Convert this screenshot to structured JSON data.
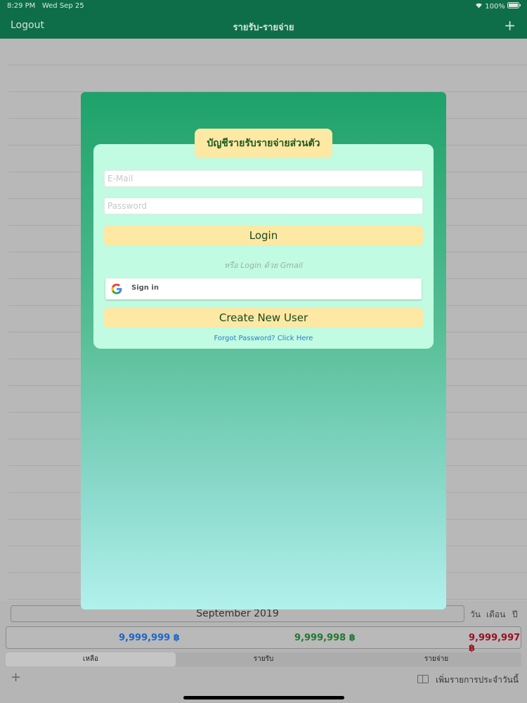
{
  "status_bar": {
    "time": "8:29 PM",
    "date": "Wed Sep 25",
    "battery": "100%"
  },
  "nav": {
    "logout_label": "Logout",
    "title": "รายรับ-รายจ่าย",
    "add_icon": "plus-icon"
  },
  "modal": {
    "header_badge": "บัญชีรายรับรายจ่ายส่วนตัว",
    "email_placeholder": "E-Mail",
    "password_placeholder": "Password",
    "login_label": "Login",
    "or_text": "หรือ Login ด้วย Gmail",
    "google_sign_in_label": "Sign in",
    "create_user_label": "Create New User",
    "forgot_password_label": "Forgot Password? Click Here"
  },
  "bottom": {
    "month": "September 2019",
    "periods": [
      "วัน",
      "เดือน",
      "ปี"
    ],
    "totals": [
      {
        "value": "9,999,999 ฿",
        "color": "#1a67c9"
      },
      {
        "value": "9,999,998 ฿",
        "color": "#1e7a2e"
      },
      {
        "value": "9,999,997 ฿",
        "color": "#9b1020"
      }
    ],
    "tabs": [
      "เหลือ",
      "รายรับ",
      "รายจ่าย"
    ],
    "selected_tab": 0,
    "daily_link": "เพิ่มรายการประจำวันนี้"
  },
  "colors": {
    "nav_bg": "#0e6e49",
    "modal_top": "#1ea26a",
    "modal_bottom": "#b2f1ec",
    "card_bg": "#c0fbe2",
    "button_yellow": "#fde8a4"
  }
}
